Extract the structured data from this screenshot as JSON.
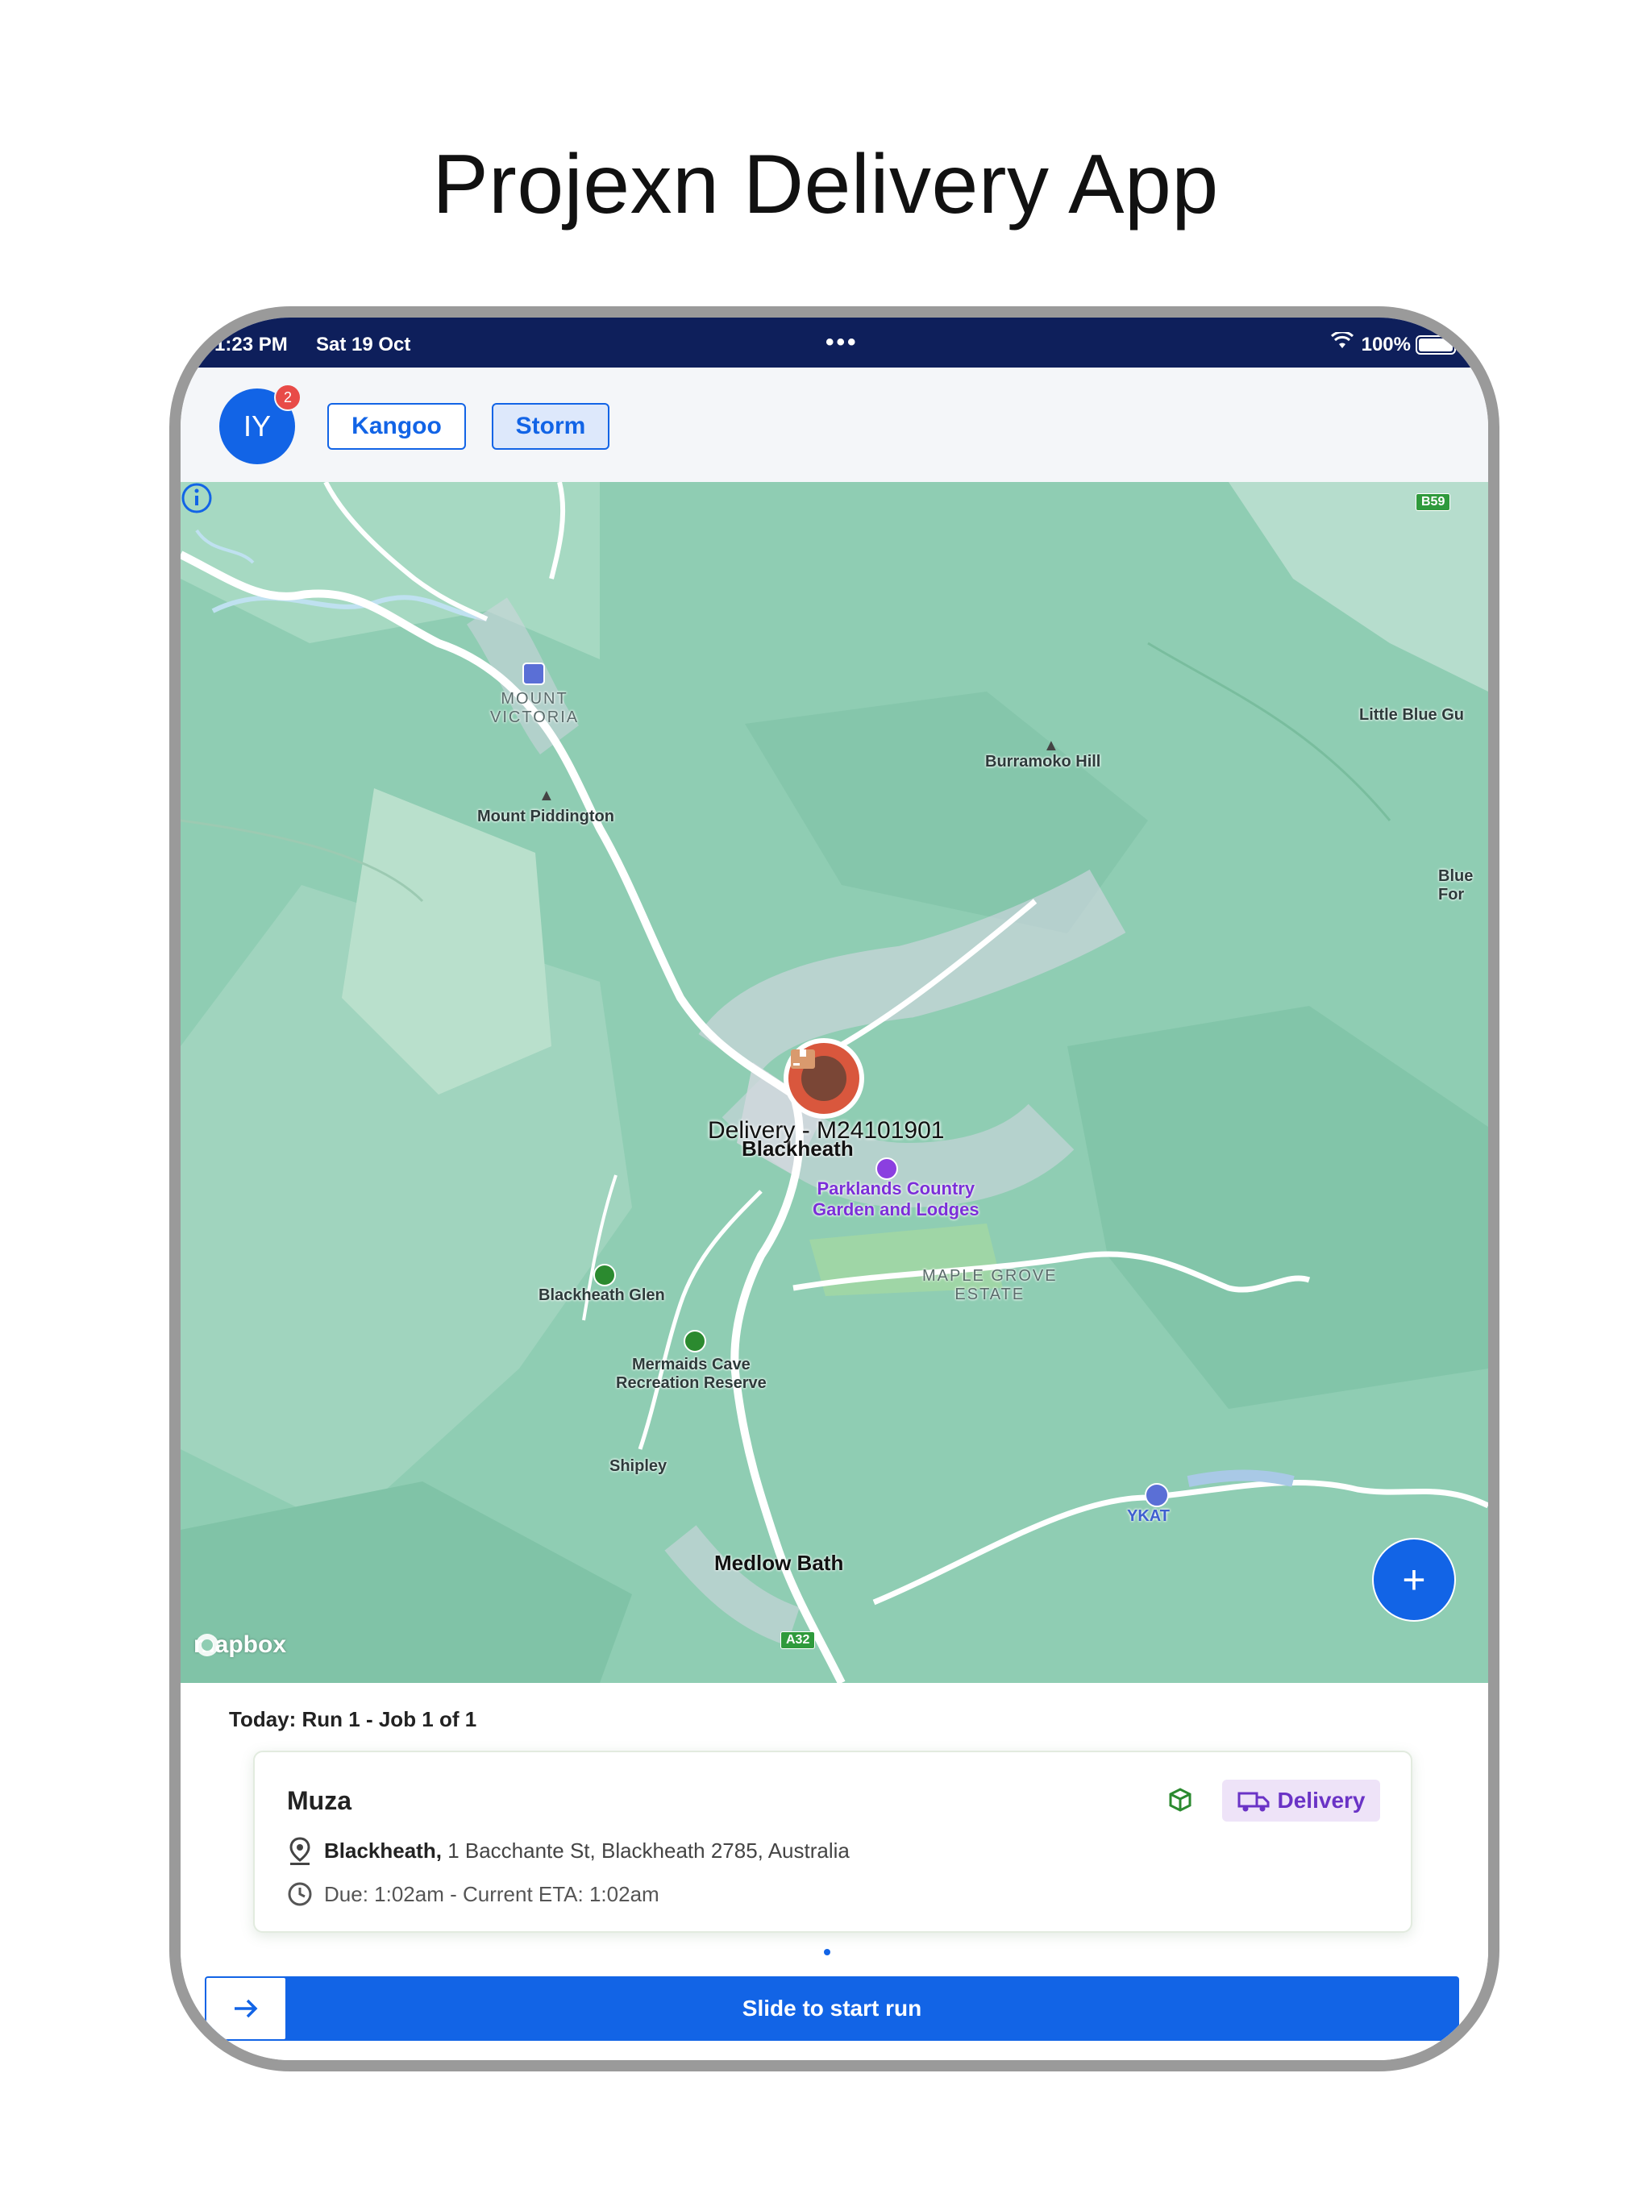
{
  "page": {
    "title": "Projexn Delivery App"
  },
  "status_bar": {
    "time": "1:23 PM",
    "date": "Sat 19 Oct",
    "battery": "100%"
  },
  "header": {
    "avatar_initials": "IY",
    "notification_count": "2",
    "vehicle_buttons": [
      "Kangoo",
      "Storm"
    ],
    "selected_vehicle": "Storm"
  },
  "map": {
    "marker_label": "Delivery - M24101901",
    "provider": "mapbox",
    "labels": {
      "mount_victoria": "MOUNT\nVICTORIA",
      "mount_piddington": "Mount Piddington",
      "burramoko_hill": "Burramoko Hill",
      "little_blue": "Little Blue Gu",
      "blue_for": "Blue\nFor",
      "blackheath": "Blackheath",
      "parklands": "Parklands Country\nGarden and Lodges",
      "maple_grove": "MAPLE GROVE\nESTATE",
      "blackheath_glen": "Blackheath Glen",
      "mermaids_cave": "Mermaids Cave\nRecreation Reserve",
      "shipley": "Shipley",
      "medlow_bath": "Medlow Bath",
      "ykat": "YKAT",
      "b59": "B59",
      "a32": "A32"
    },
    "fab_label": "+"
  },
  "run": {
    "summary": "Today: Run 1 - Job 1 of 1",
    "job": {
      "customer": "Muza",
      "type": "Delivery",
      "suburb": "Blackheath,",
      "address": "1 Bacchante St, Blackheath 2785, Australia",
      "due": "Due: 1:02am - Current ETA: 1:02am"
    },
    "slider_label": "Slide to start run"
  },
  "colors": {
    "primary": "#1264e6",
    "status_bar": "#0e1f5b",
    "map_green": "#8fcdb3",
    "marker": "#d9573d",
    "delivery_purple": "#6a33c6"
  }
}
